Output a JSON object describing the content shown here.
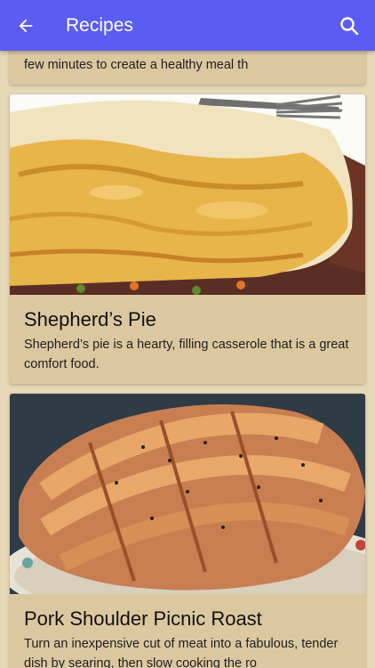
{
  "appbar": {
    "title": "Recipes",
    "back_icon": "arrow-left-icon",
    "search_icon": "search-icon",
    "color": "#5b5cf2"
  },
  "recipes": [
    {
      "name": "",
      "description": "few minutes to create a healthy meal th"
    },
    {
      "name": "Shepherd’s Pie",
      "description": "Shepherd’s pie is a hearty, filling casserole that is a great comfort food."
    },
    {
      "name": "Pork Shoulder Picnic Roast",
      "description": "Turn an inexpensive cut of meat into a fabulous, tender dish by searing, then slow cooking the ro"
    }
  ]
}
